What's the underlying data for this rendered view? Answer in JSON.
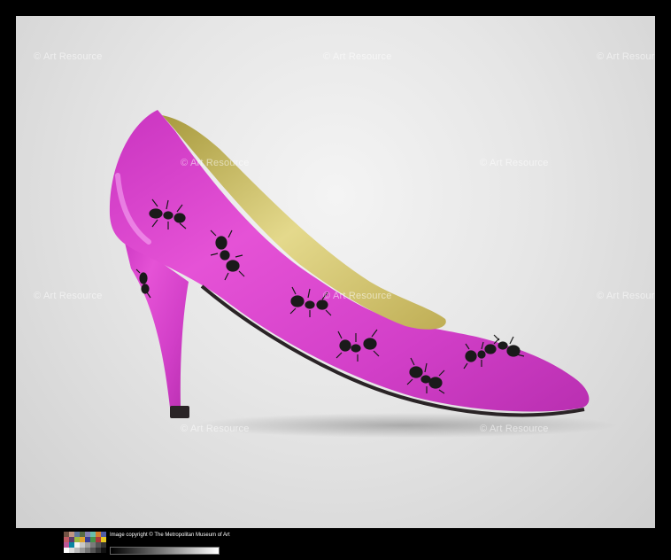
{
  "watermark": "© Art Resource",
  "copyright": "Image copyright © The Metropolitan Museum of Art",
  "colors": {
    "satin": "#d63fc9",
    "lining": "#d8c878",
    "ant": "#1a1a1a"
  }
}
